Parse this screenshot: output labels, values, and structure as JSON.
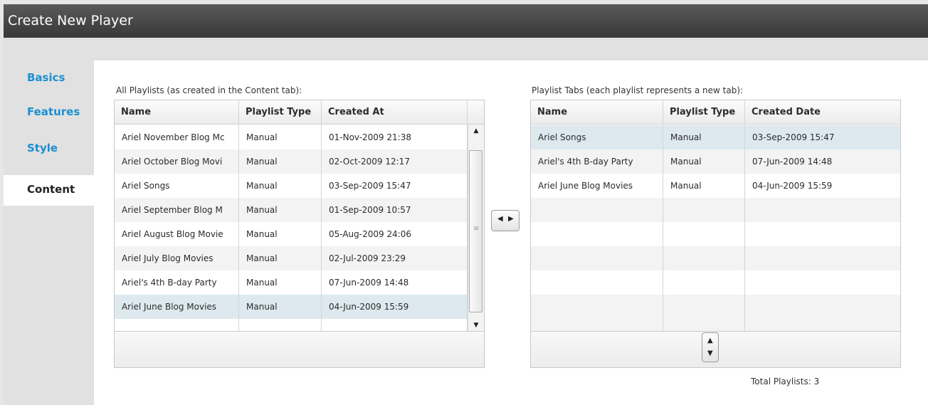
{
  "header": {
    "title": "Create New Player"
  },
  "sidebar": {
    "items": [
      {
        "label": "Basics"
      },
      {
        "label": "Features"
      },
      {
        "label": "Style"
      },
      {
        "label": "Content"
      }
    ]
  },
  "left_panel": {
    "caption": "All Playlists (as created in the Content tab):",
    "columns": [
      "Name",
      "Playlist Type",
      "Created At"
    ],
    "rows": [
      [
        "Ariel November Blog Mc",
        "Manual",
        "01-Nov-2009 21:38"
      ],
      [
        "Ariel October Blog Movi",
        "Manual",
        "02-Oct-2009 12:17"
      ],
      [
        "Ariel Songs",
        "Manual",
        "03-Sep-2009 15:47"
      ],
      [
        "Ariel September Blog M",
        "Manual",
        "01-Sep-2009 10:57"
      ],
      [
        "Ariel August Blog Movie",
        "Manual",
        "05-Aug-2009 24:06"
      ],
      [
        "Ariel July Blog Movies",
        "Manual",
        "02-Jul-2009 23:29"
      ],
      [
        "Ariel's 4th B-day Party",
        "Manual",
        "07-Jun-2009 14:48"
      ],
      [
        "Ariel June Blog Movies",
        "Manual",
        "04-Jun-2009 15:59"
      ],
      [
        "",
        "",
        ""
      ]
    ]
  },
  "right_panel": {
    "caption": "Playlist Tabs (each playlist represents a new tab):",
    "columns": [
      "Name",
      "Playlist Type",
      "Created Date"
    ],
    "rows": [
      [
        "Ariel Songs",
        "Manual",
        "03-Sep-2009 15:47"
      ],
      [
        "Ariel's 4th B-day Party",
        "Manual",
        "07-Jun-2009 14:48"
      ],
      [
        "Ariel June Blog Movies",
        "Manual",
        "04-Jun-2009 15:59"
      ],
      [
        "",
        "",
        ""
      ],
      [
        "",
        "",
        ""
      ],
      [
        "",
        "",
        ""
      ],
      [
        "",
        "",
        ""
      ],
      [
        "",
        "",
        ""
      ]
    ],
    "total_label": "Total Playlists: 3"
  },
  "icons": {
    "left_arrow": "◀",
    "right_arrow": "▶",
    "up_arrow": "▲",
    "down_arrow": "▼",
    "grip": "≡"
  },
  "colors": {
    "titlebar": "#404040",
    "nav_link": "#1b8fd1",
    "selected_row": "#dde9ef"
  }
}
